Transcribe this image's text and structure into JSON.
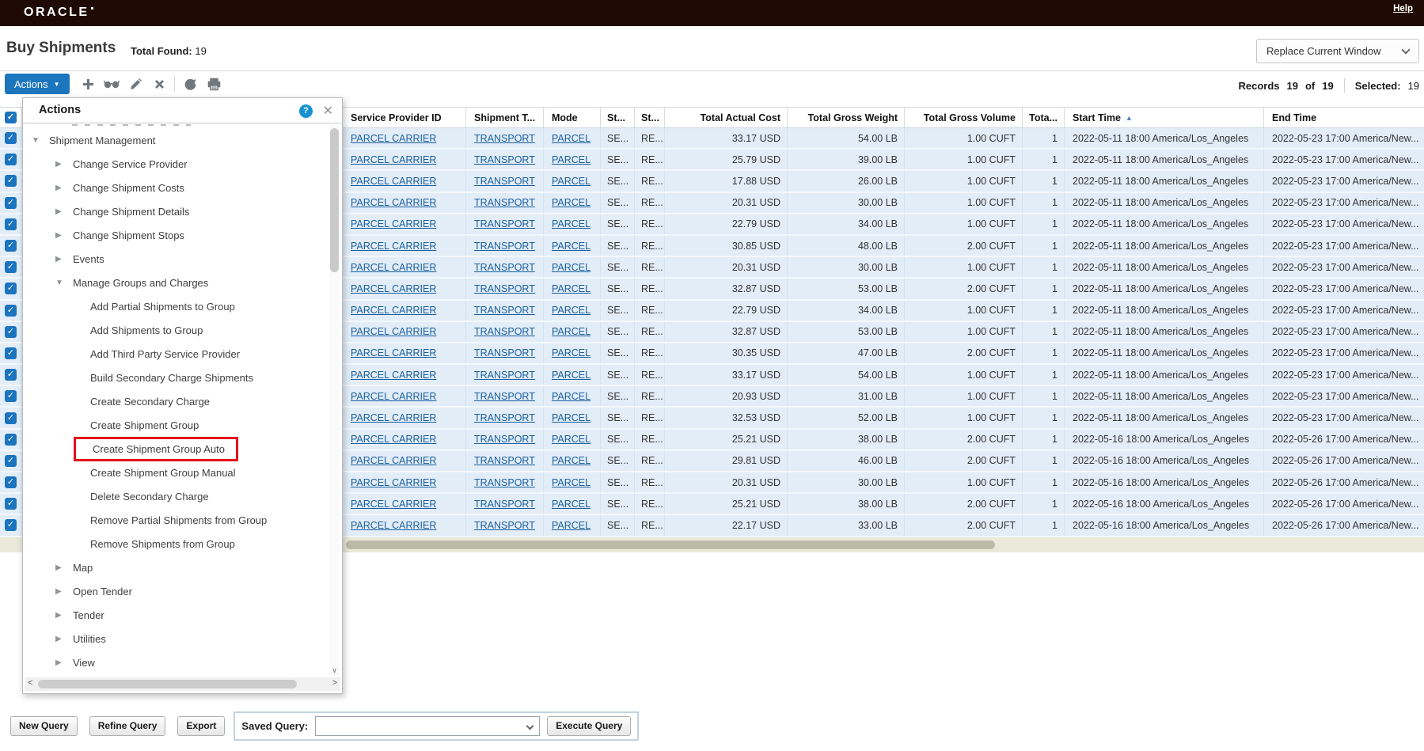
{
  "topbar": {
    "brand": "ORACLE",
    "help": "Help"
  },
  "page": {
    "title": "Buy Shipments",
    "total_found_label": "Total Found:",
    "total_found_value": "19",
    "window_mode": "Replace Current Window"
  },
  "toolbar": {
    "actions_label": "Actions",
    "icons": [
      "plus-icon",
      "glasses-icon",
      "pencil-icon",
      "delete-icon",
      "refresh-icon",
      "print-icon"
    ],
    "records_label": "Records",
    "records_count": "19",
    "of_label": "of",
    "records_total": "19",
    "selected_label": "Selected:",
    "selected_count": "19"
  },
  "actions_popup": {
    "title": "Actions",
    "items": [
      {
        "label": "Shipment Management",
        "indent": 0,
        "state": "expanded"
      },
      {
        "label": "Change Service Provider",
        "indent": 1,
        "state": "collapsed"
      },
      {
        "label": "Change Shipment Costs",
        "indent": 1,
        "state": "collapsed"
      },
      {
        "label": "Change Shipment Details",
        "indent": 1,
        "state": "collapsed"
      },
      {
        "label": "Change Shipment Stops",
        "indent": 1,
        "state": "collapsed"
      },
      {
        "label": "Events",
        "indent": 1,
        "state": "collapsed"
      },
      {
        "label": "Manage Groups and Charges",
        "indent": 1,
        "state": "expanded"
      },
      {
        "label": "Add Partial Shipments to Group",
        "indent": 2,
        "state": "leaf"
      },
      {
        "label": "Add Shipments to Group",
        "indent": 2,
        "state": "leaf"
      },
      {
        "label": "Add Third Party Service Provider",
        "indent": 2,
        "state": "leaf"
      },
      {
        "label": "Build Secondary Charge Shipments",
        "indent": 2,
        "state": "leaf"
      },
      {
        "label": "Create Secondary Charge",
        "indent": 2,
        "state": "leaf"
      },
      {
        "label": "Create Shipment Group",
        "indent": 2,
        "state": "leaf"
      },
      {
        "label": "Create Shipment Group Auto",
        "indent": 2,
        "state": "leaf",
        "highlighted": true
      },
      {
        "label": "Create Shipment Group Manual",
        "indent": 2,
        "state": "leaf"
      },
      {
        "label": "Delete Secondary Charge",
        "indent": 2,
        "state": "leaf"
      },
      {
        "label": "Remove Partial Shipments from Group",
        "indent": 2,
        "state": "leaf"
      },
      {
        "label": "Remove Shipments from Group",
        "indent": 2,
        "state": "leaf"
      },
      {
        "label": "Map",
        "indent": 1,
        "state": "collapsed"
      },
      {
        "label": "Open Tender",
        "indent": 1,
        "state": "collapsed"
      },
      {
        "label": "Tender",
        "indent": 1,
        "state": "collapsed"
      },
      {
        "label": "Utilities",
        "indent": 1,
        "state": "collapsed"
      },
      {
        "label": "View",
        "indent": 1,
        "state": "collapsed"
      }
    ],
    "highlight_color": "#e4121b"
  },
  "table": {
    "columns": [
      {
        "label": "Service Provider ID",
        "key": "provider",
        "align": "left",
        "link": true
      },
      {
        "label": "Shipment T...",
        "key": "shipment_type",
        "align": "left",
        "link": true
      },
      {
        "label": "Mode",
        "key": "mode",
        "align": "left",
        "link": true
      },
      {
        "label": "St...",
        "key": "status1",
        "align": "left",
        "link": false
      },
      {
        "label": "St...",
        "key": "status2",
        "align": "left",
        "link": false
      },
      {
        "label": "Total Actual Cost",
        "key": "cost",
        "align": "right",
        "link": false
      },
      {
        "label": "Total Gross Weight",
        "key": "weight",
        "align": "right",
        "link": false
      },
      {
        "label": "Total Gross Volume",
        "key": "volume",
        "align": "right",
        "link": false
      },
      {
        "label": "Tota...",
        "key": "total",
        "align": "right",
        "link": false
      },
      {
        "label": "Start Time",
        "key": "start",
        "align": "left",
        "link": false,
        "sort": "asc"
      },
      {
        "label": "End Time",
        "key": "end",
        "align": "left",
        "link": false
      }
    ],
    "rows": [
      {
        "provider": "PARCEL CARRIER",
        "shipment_type": "TRANSPORT",
        "mode": "PARCEL",
        "status1": "SE...",
        "status2": "RE...",
        "cost": "33.17 USD",
        "weight": "54.00 LB",
        "volume": "1.00 CUFT",
        "total": "1",
        "start": "2022-05-11 18:00 America/Los_Angeles",
        "end": "2022-05-23 17:00 America/New..."
      },
      {
        "provider": "PARCEL CARRIER",
        "shipment_type": "TRANSPORT",
        "mode": "PARCEL",
        "status1": "SE...",
        "status2": "RE...",
        "cost": "25.79 USD",
        "weight": "39.00 LB",
        "volume": "1.00 CUFT",
        "total": "1",
        "start": "2022-05-11 18:00 America/Los_Angeles",
        "end": "2022-05-23 17:00 America/New..."
      },
      {
        "provider": "PARCEL CARRIER",
        "shipment_type": "TRANSPORT",
        "mode": "PARCEL",
        "status1": "SE...",
        "status2": "RE...",
        "cost": "17.88 USD",
        "weight": "26.00 LB",
        "volume": "1.00 CUFT",
        "total": "1",
        "start": "2022-05-11 18:00 America/Los_Angeles",
        "end": "2022-05-23 17:00 America/New..."
      },
      {
        "provider": "PARCEL CARRIER",
        "shipment_type": "TRANSPORT",
        "mode": "PARCEL",
        "status1": "SE...",
        "status2": "RE...",
        "cost": "20.31 USD",
        "weight": "30.00 LB",
        "volume": "1.00 CUFT",
        "total": "1",
        "start": "2022-05-11 18:00 America/Los_Angeles",
        "end": "2022-05-23 17:00 America/New..."
      },
      {
        "provider": "PARCEL CARRIER",
        "shipment_type": "TRANSPORT",
        "mode": "PARCEL",
        "status1": "SE...",
        "status2": "RE...",
        "cost": "22.79 USD",
        "weight": "34.00 LB",
        "volume": "1.00 CUFT",
        "total": "1",
        "start": "2022-05-11 18:00 America/Los_Angeles",
        "end": "2022-05-23 17:00 America/New..."
      },
      {
        "provider": "PARCEL CARRIER",
        "shipment_type": "TRANSPORT",
        "mode": "PARCEL",
        "status1": "SE...",
        "status2": "RE...",
        "cost": "30.85 USD",
        "weight": "48.00 LB",
        "volume": "2.00 CUFT",
        "total": "1",
        "start": "2022-05-11 18:00 America/Los_Angeles",
        "end": "2022-05-23 17:00 America/New..."
      },
      {
        "provider": "PARCEL CARRIER",
        "shipment_type": "TRANSPORT",
        "mode": "PARCEL",
        "status1": "SE...",
        "status2": "RE...",
        "cost": "20.31 USD",
        "weight": "30.00 LB",
        "volume": "1.00 CUFT",
        "total": "1",
        "start": "2022-05-11 18:00 America/Los_Angeles",
        "end": "2022-05-23 17:00 America/New..."
      },
      {
        "provider": "PARCEL CARRIER",
        "shipment_type": "TRANSPORT",
        "mode": "PARCEL",
        "status1": "SE...",
        "status2": "RE...",
        "cost": "32.87 USD",
        "weight": "53.00 LB",
        "volume": "2.00 CUFT",
        "total": "1",
        "start": "2022-05-11 18:00 America/Los_Angeles",
        "end": "2022-05-23 17:00 America/New..."
      },
      {
        "provider": "PARCEL CARRIER",
        "shipment_type": "TRANSPORT",
        "mode": "PARCEL",
        "status1": "SE...",
        "status2": "RE...",
        "cost": "22.79 USD",
        "weight": "34.00 LB",
        "volume": "1.00 CUFT",
        "total": "1",
        "start": "2022-05-11 18:00 America/Los_Angeles",
        "end": "2022-05-23 17:00 America/New..."
      },
      {
        "provider": "PARCEL CARRIER",
        "shipment_type": "TRANSPORT",
        "mode": "PARCEL",
        "status1": "SE...",
        "status2": "RE...",
        "cost": "32.87 USD",
        "weight": "53.00 LB",
        "volume": "1.00 CUFT",
        "total": "1",
        "start": "2022-05-11 18:00 America/Los_Angeles",
        "end": "2022-05-23 17:00 America/New..."
      },
      {
        "provider": "PARCEL CARRIER",
        "shipment_type": "TRANSPORT",
        "mode": "PARCEL",
        "status1": "SE...",
        "status2": "RE...",
        "cost": "30.35 USD",
        "weight": "47.00 LB",
        "volume": "2.00 CUFT",
        "total": "1",
        "start": "2022-05-11 18:00 America/Los_Angeles",
        "end": "2022-05-23 17:00 America/New..."
      },
      {
        "provider": "PARCEL CARRIER",
        "shipment_type": "TRANSPORT",
        "mode": "PARCEL",
        "status1": "SE...",
        "status2": "RE...",
        "cost": "33.17 USD",
        "weight": "54.00 LB",
        "volume": "1.00 CUFT",
        "total": "1",
        "start": "2022-05-11 18:00 America/Los_Angeles",
        "end": "2022-05-23 17:00 America/New..."
      },
      {
        "provider": "PARCEL CARRIER",
        "shipment_type": "TRANSPORT",
        "mode": "PARCEL",
        "status1": "SE...",
        "status2": "RE...",
        "cost": "20.93 USD",
        "weight": "31.00 LB",
        "volume": "1.00 CUFT",
        "total": "1",
        "start": "2022-05-11 18:00 America/Los_Angeles",
        "end": "2022-05-23 17:00 America/New..."
      },
      {
        "provider": "PARCEL CARRIER",
        "shipment_type": "TRANSPORT",
        "mode": "PARCEL",
        "status1": "SE...",
        "status2": "RE...",
        "cost": "32.53 USD",
        "weight": "52.00 LB",
        "volume": "1.00 CUFT",
        "total": "1",
        "start": "2022-05-11 18:00 America/Los_Angeles",
        "end": "2022-05-23 17:00 America/New..."
      },
      {
        "provider": "PARCEL CARRIER",
        "shipment_type": "TRANSPORT",
        "mode": "PARCEL",
        "status1": "SE...",
        "status2": "RE...",
        "cost": "25.21 USD",
        "weight": "38.00 LB",
        "volume": "2.00 CUFT",
        "total": "1",
        "start": "2022-05-16 18:00 America/Los_Angeles",
        "end": "2022-05-26 17:00 America/New..."
      },
      {
        "provider": "PARCEL CARRIER",
        "shipment_type": "TRANSPORT",
        "mode": "PARCEL",
        "status1": "SE...",
        "status2": "RE...",
        "cost": "29.81 USD",
        "weight": "46.00 LB",
        "volume": "2.00 CUFT",
        "total": "1",
        "start": "2022-05-16 18:00 America/Los_Angeles",
        "end": "2022-05-26 17:00 America/New..."
      },
      {
        "provider": "PARCEL CARRIER",
        "shipment_type": "TRANSPORT",
        "mode": "PARCEL",
        "status1": "SE...",
        "status2": "RE...",
        "cost": "20.31 USD",
        "weight": "30.00 LB",
        "volume": "1.00 CUFT",
        "total": "1",
        "start": "2022-05-16 18:00 America/Los_Angeles",
        "end": "2022-05-26 17:00 America/New..."
      },
      {
        "provider": "PARCEL CARRIER",
        "shipment_type": "TRANSPORT",
        "mode": "PARCEL",
        "status1": "SE...",
        "status2": "RE...",
        "cost": "25.21 USD",
        "weight": "38.00 LB",
        "volume": "2.00 CUFT",
        "total": "1",
        "start": "2022-05-16 18:00 America/Los_Angeles",
        "end": "2022-05-26 17:00 America/New..."
      },
      {
        "provider": "PARCEL CARRIER",
        "shipment_type": "TRANSPORT",
        "mode": "PARCEL",
        "status1": "SE...",
        "status2": "RE...",
        "cost": "22.17 USD",
        "weight": "33.00 LB",
        "volume": "2.00 CUFT",
        "total": "1",
        "start": "2022-05-16 18:00 America/Los_Angeles",
        "end": "2022-05-26 17:00 America/New..."
      }
    ]
  },
  "query_bar": {
    "new_query": "New Query",
    "refine_query": "Refine Query",
    "export": "Export",
    "saved_query_label": "Saved Query:",
    "saved_query_value": "",
    "execute_query": "Execute Query"
  },
  "colors": {
    "accent_blue": "#1b76bd",
    "row_blue": "#e2edf8",
    "brand_bar": "#1e0a02",
    "highlight_red": "#e4121b"
  }
}
